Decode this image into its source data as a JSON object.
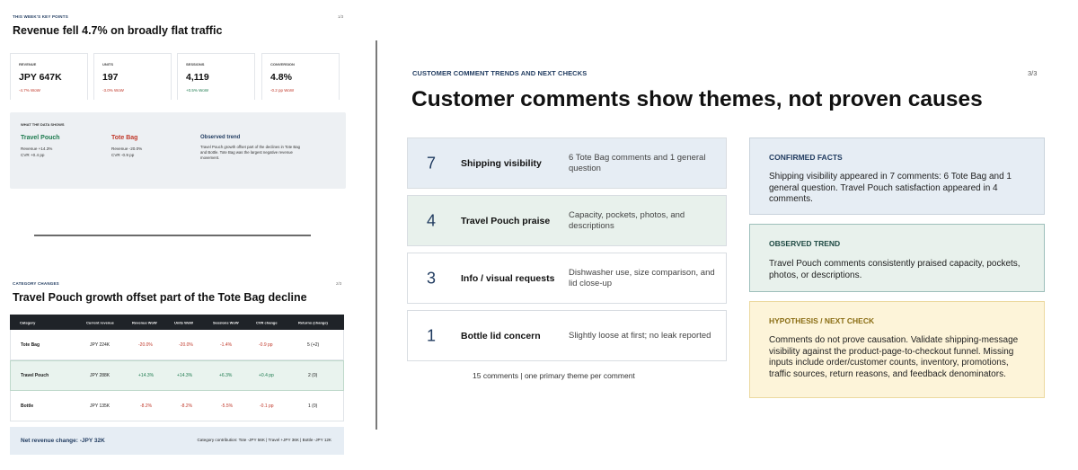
{
  "left": {
    "slide1": {
      "eyebrow": "THIS WEEK'S KEY POINTS",
      "page": "1/3",
      "title": "Revenue fell 4.7% on broadly flat traffic",
      "kpis": [
        {
          "label": "REVENUE",
          "value": "JPY 647K",
          "change": "-4.7% WoW",
          "trend": "neg"
        },
        {
          "label": "UNITS",
          "value": "197",
          "change": "-3.0% WoW",
          "trend": "neg"
        },
        {
          "label": "SESSIONS",
          "value": "4,119",
          "change": "+0.5% WoW",
          "trend": "pos"
        },
        {
          "label": "CONVERSION",
          "value": "4.8%",
          "change": "-0.2 pp WoW",
          "trend": "neg"
        }
      ],
      "data_shows": {
        "header": "WHAT THE DATA SHOWS",
        "travel_pouch": {
          "title": "Travel Pouch",
          "line1": "Revenue +14.3%",
          "line2": "CVR +0.4 pp"
        },
        "tote_bag": {
          "title": "Tote Bag",
          "line1": "Revenue -20.0%",
          "line2": "CVR -0.9 pp"
        },
        "observed": {
          "title": "Observed trend",
          "line1": "Travel Pouch growth offset part of the declines in Tote Bag",
          "line2": "and Bottle. Tote Bag was the largest negative revenue",
          "line3": "movement."
        }
      }
    },
    "slide2": {
      "eyebrow": "CATEGORY CHANGES",
      "page": "2/3",
      "title": "Travel Pouch growth offset part of the Tote Bag decline",
      "columns": [
        "Category",
        "Current revenue",
        "Revenue WoW",
        "Units WoW",
        "Sessions WoW",
        "CVR change",
        "Returns (change)"
      ],
      "rows": [
        {
          "category": "Tote Bag",
          "revenue": "JPY 224K",
          "rev_wow": "-20.0%",
          "units_wow": "-20.0%",
          "sess_wow": "-1.4%",
          "cvr": "-0.9 pp",
          "returns": "5 (+2)"
        },
        {
          "category": "Travel Pouch",
          "revenue": "JPY 288K",
          "rev_wow": "+14.3%",
          "units_wow": "+14.3%",
          "sess_wow": "+6.3%",
          "cvr": "+0.4 pp",
          "returns": "2 (0)"
        },
        {
          "category": "Bottle",
          "revenue": "JPY 135K",
          "rev_wow": "-8.2%",
          "units_wow": "-8.2%",
          "sess_wow": "-5.5%",
          "cvr": "-0.1 pp",
          "returns": "1 (0)"
        }
      ],
      "net_change": "Net revenue change: -JPY 32K",
      "contribution": "Category contribution: Tote -JPY 56K  |  Travel +JPY 36K  |  Bottle -JPY 12K"
    }
  },
  "right": {
    "eyebrow": "CUSTOMER COMMENT TRENDS AND NEXT CHECKS",
    "page": "3/3",
    "title": "Customer comments show themes, not proven causes",
    "themes": [
      {
        "count": "7",
        "name": "Shipping visibility",
        "desc": "6 Tote Bag comments and 1 general question"
      },
      {
        "count": "4",
        "name": "Travel Pouch praise",
        "desc": "Capacity, pockets, photos, and descriptions"
      },
      {
        "count": "3",
        "name": "Info / visual requests",
        "desc": "Dishwasher use, size comparison, and lid close-up"
      },
      {
        "count": "1",
        "name": "Bottle lid concern",
        "desc": "Slightly loose at first; no leak reported"
      }
    ],
    "footnote": "15 comments  |  one primary theme per comment",
    "facts": {
      "header": "CONFIRMED FACTS",
      "text": "Shipping visibility appeared in 7 comments: 6 Tote Bag and 1 general question. Travel Pouch satisfaction appeared in 4 comments."
    },
    "trend": {
      "header": "OBSERVED TREND",
      "text": "Travel Pouch comments consistently praised capacity, pockets, photos, or descriptions."
    },
    "hypothesis": {
      "header": "HYPOTHESIS / NEXT CHECK",
      "text": "Comments do not prove causation. Validate shipping-message visibility against the product-page-to-checkout funnel. Missing inputs include order/customer counts, inventory, promotions, traffic sources, return reasons, and feedback denominators."
    }
  }
}
